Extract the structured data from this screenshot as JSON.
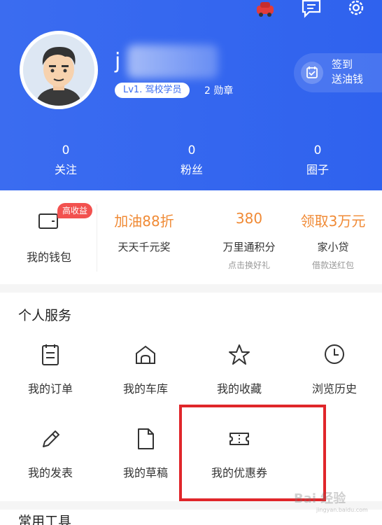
{
  "header": {
    "username_partial": "j",
    "level_badge": "Lv1. 驾校学员",
    "medals": "2 勋章",
    "signin": {
      "line1": "签到",
      "line2": "送油钱"
    },
    "stats": [
      {
        "value": "0",
        "label": "关注"
      },
      {
        "value": "0",
        "label": "粉丝"
      },
      {
        "value": "0",
        "label": "圈子"
      }
    ]
  },
  "wallet": {
    "badge": "高收益",
    "label": "我的钱包"
  },
  "promos": [
    {
      "title": "加油88折",
      "subtitle": "天天千元奖",
      "note": ""
    },
    {
      "title": "380",
      "subtitle": "万里通积分",
      "note": "点击换好礼"
    },
    {
      "title": "领取3万元",
      "subtitle": "家小贷",
      "note": "借款送红包"
    }
  ],
  "services": {
    "title": "个人服务",
    "items": [
      {
        "label": "我的订单",
        "icon": "order-icon"
      },
      {
        "label": "我的车库",
        "icon": "garage-icon"
      },
      {
        "label": "我的收藏",
        "icon": "star-icon"
      },
      {
        "label": "浏览历史",
        "icon": "clock-icon"
      },
      {
        "label": "我的发表",
        "icon": "pencil-icon"
      },
      {
        "label": "我的草稿",
        "icon": "draft-icon"
      },
      {
        "label": "我的优惠券",
        "icon": "coupon-icon"
      }
    ]
  },
  "tools": {
    "title": "常用工具"
  },
  "watermark": {
    "text": "Bai 经验",
    "sub": "jingyan.baidu.com"
  },
  "colors": {
    "header_blue": "#3b6cf0",
    "promo_orange": "#f08a35",
    "badge_red": "#f2514f",
    "highlight_red": "#e0262a"
  }
}
